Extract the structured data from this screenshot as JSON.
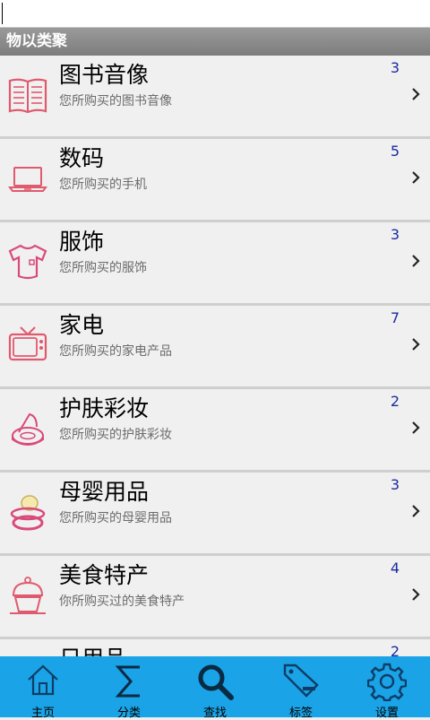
{
  "header": {
    "title": "物以类聚"
  },
  "categories": [
    {
      "title": "图书音像",
      "subtitle": "您所购买的图书音像",
      "count": "3",
      "icon": "book-icon"
    },
    {
      "title": "数码",
      "subtitle": "您所购买的手机",
      "count": "5",
      "icon": "laptop-icon"
    },
    {
      "title": "服饰",
      "subtitle": "您所购买的服饰",
      "count": "3",
      "icon": "onesie-icon"
    },
    {
      "title": "家电",
      "subtitle": "您所购买的家电产品",
      "count": "7",
      "icon": "tv-icon"
    },
    {
      "title": "护肤彩妆",
      "subtitle": "您所购买的护肤彩妆",
      "count": "2",
      "icon": "compact-icon"
    },
    {
      "title": "母婴用品",
      "subtitle": "您所购买的母婴用品",
      "count": "3",
      "icon": "pacifier-icon"
    },
    {
      "title": "美食特产",
      "subtitle": "你所购买过的美食特产",
      "count": "4",
      "icon": "cupcake-icon"
    },
    {
      "title": "日用品",
      "subtitle": "",
      "count": "2",
      "icon": "daily-icon"
    }
  ],
  "tabs": [
    {
      "label": "主页",
      "icon": "home-icon"
    },
    {
      "label": "分类",
      "icon": "sigma-icon"
    },
    {
      "label": "查找",
      "icon": "search-icon"
    },
    {
      "label": "标签",
      "icon": "tag-icon"
    },
    {
      "label": "设置",
      "icon": "gear-icon"
    }
  ],
  "colors": {
    "tabbar": "#1aa3e6",
    "count": "#1a2ca0",
    "icon_accent": "#e05a6e"
  }
}
